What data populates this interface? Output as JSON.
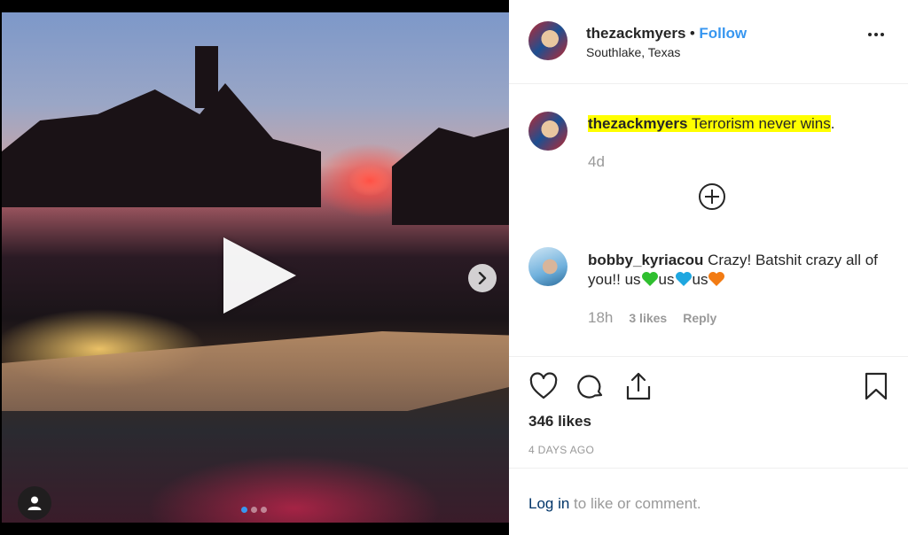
{
  "post": {
    "author": {
      "username": "thezackmyers",
      "follow_label": "Follow",
      "separator": "•",
      "location": "Southlake, Texas"
    },
    "caption": {
      "username": "thezackmyers",
      "text": "Terrorism never wins",
      "period": ".",
      "age": "4d"
    },
    "comments": [
      {
        "username": "bobby_kyriacou",
        "text_parts": [
          "Crazy! Batshit crazy all of you!! us",
          "us",
          "us"
        ],
        "hearts": [
          "green-heart",
          "blue-heart",
          "orange-heart"
        ],
        "heart_colors": [
          "#2fbf2f",
          "#1ea7e0",
          "#f27b13"
        ],
        "age": "18h",
        "likes": "3 likes",
        "reply_label": "Reply"
      }
    ],
    "like_count": "346 likes",
    "date": "4 DAYS AGO",
    "login": {
      "link": "Log in",
      "rest": " to like or comment."
    }
  },
  "media": {
    "slide_count": 3,
    "active_slide": 1,
    "icons": {
      "play": "play-icon",
      "next": "chevron-right-icon",
      "tag": "user-icon"
    }
  },
  "actions": {
    "icons": [
      "heart-icon",
      "comment-icon",
      "share-icon",
      "bookmark-icon"
    ]
  },
  "colors": {
    "link_blue": "#3897f0",
    "highlight": "#ffff00",
    "muted": "#999999"
  }
}
